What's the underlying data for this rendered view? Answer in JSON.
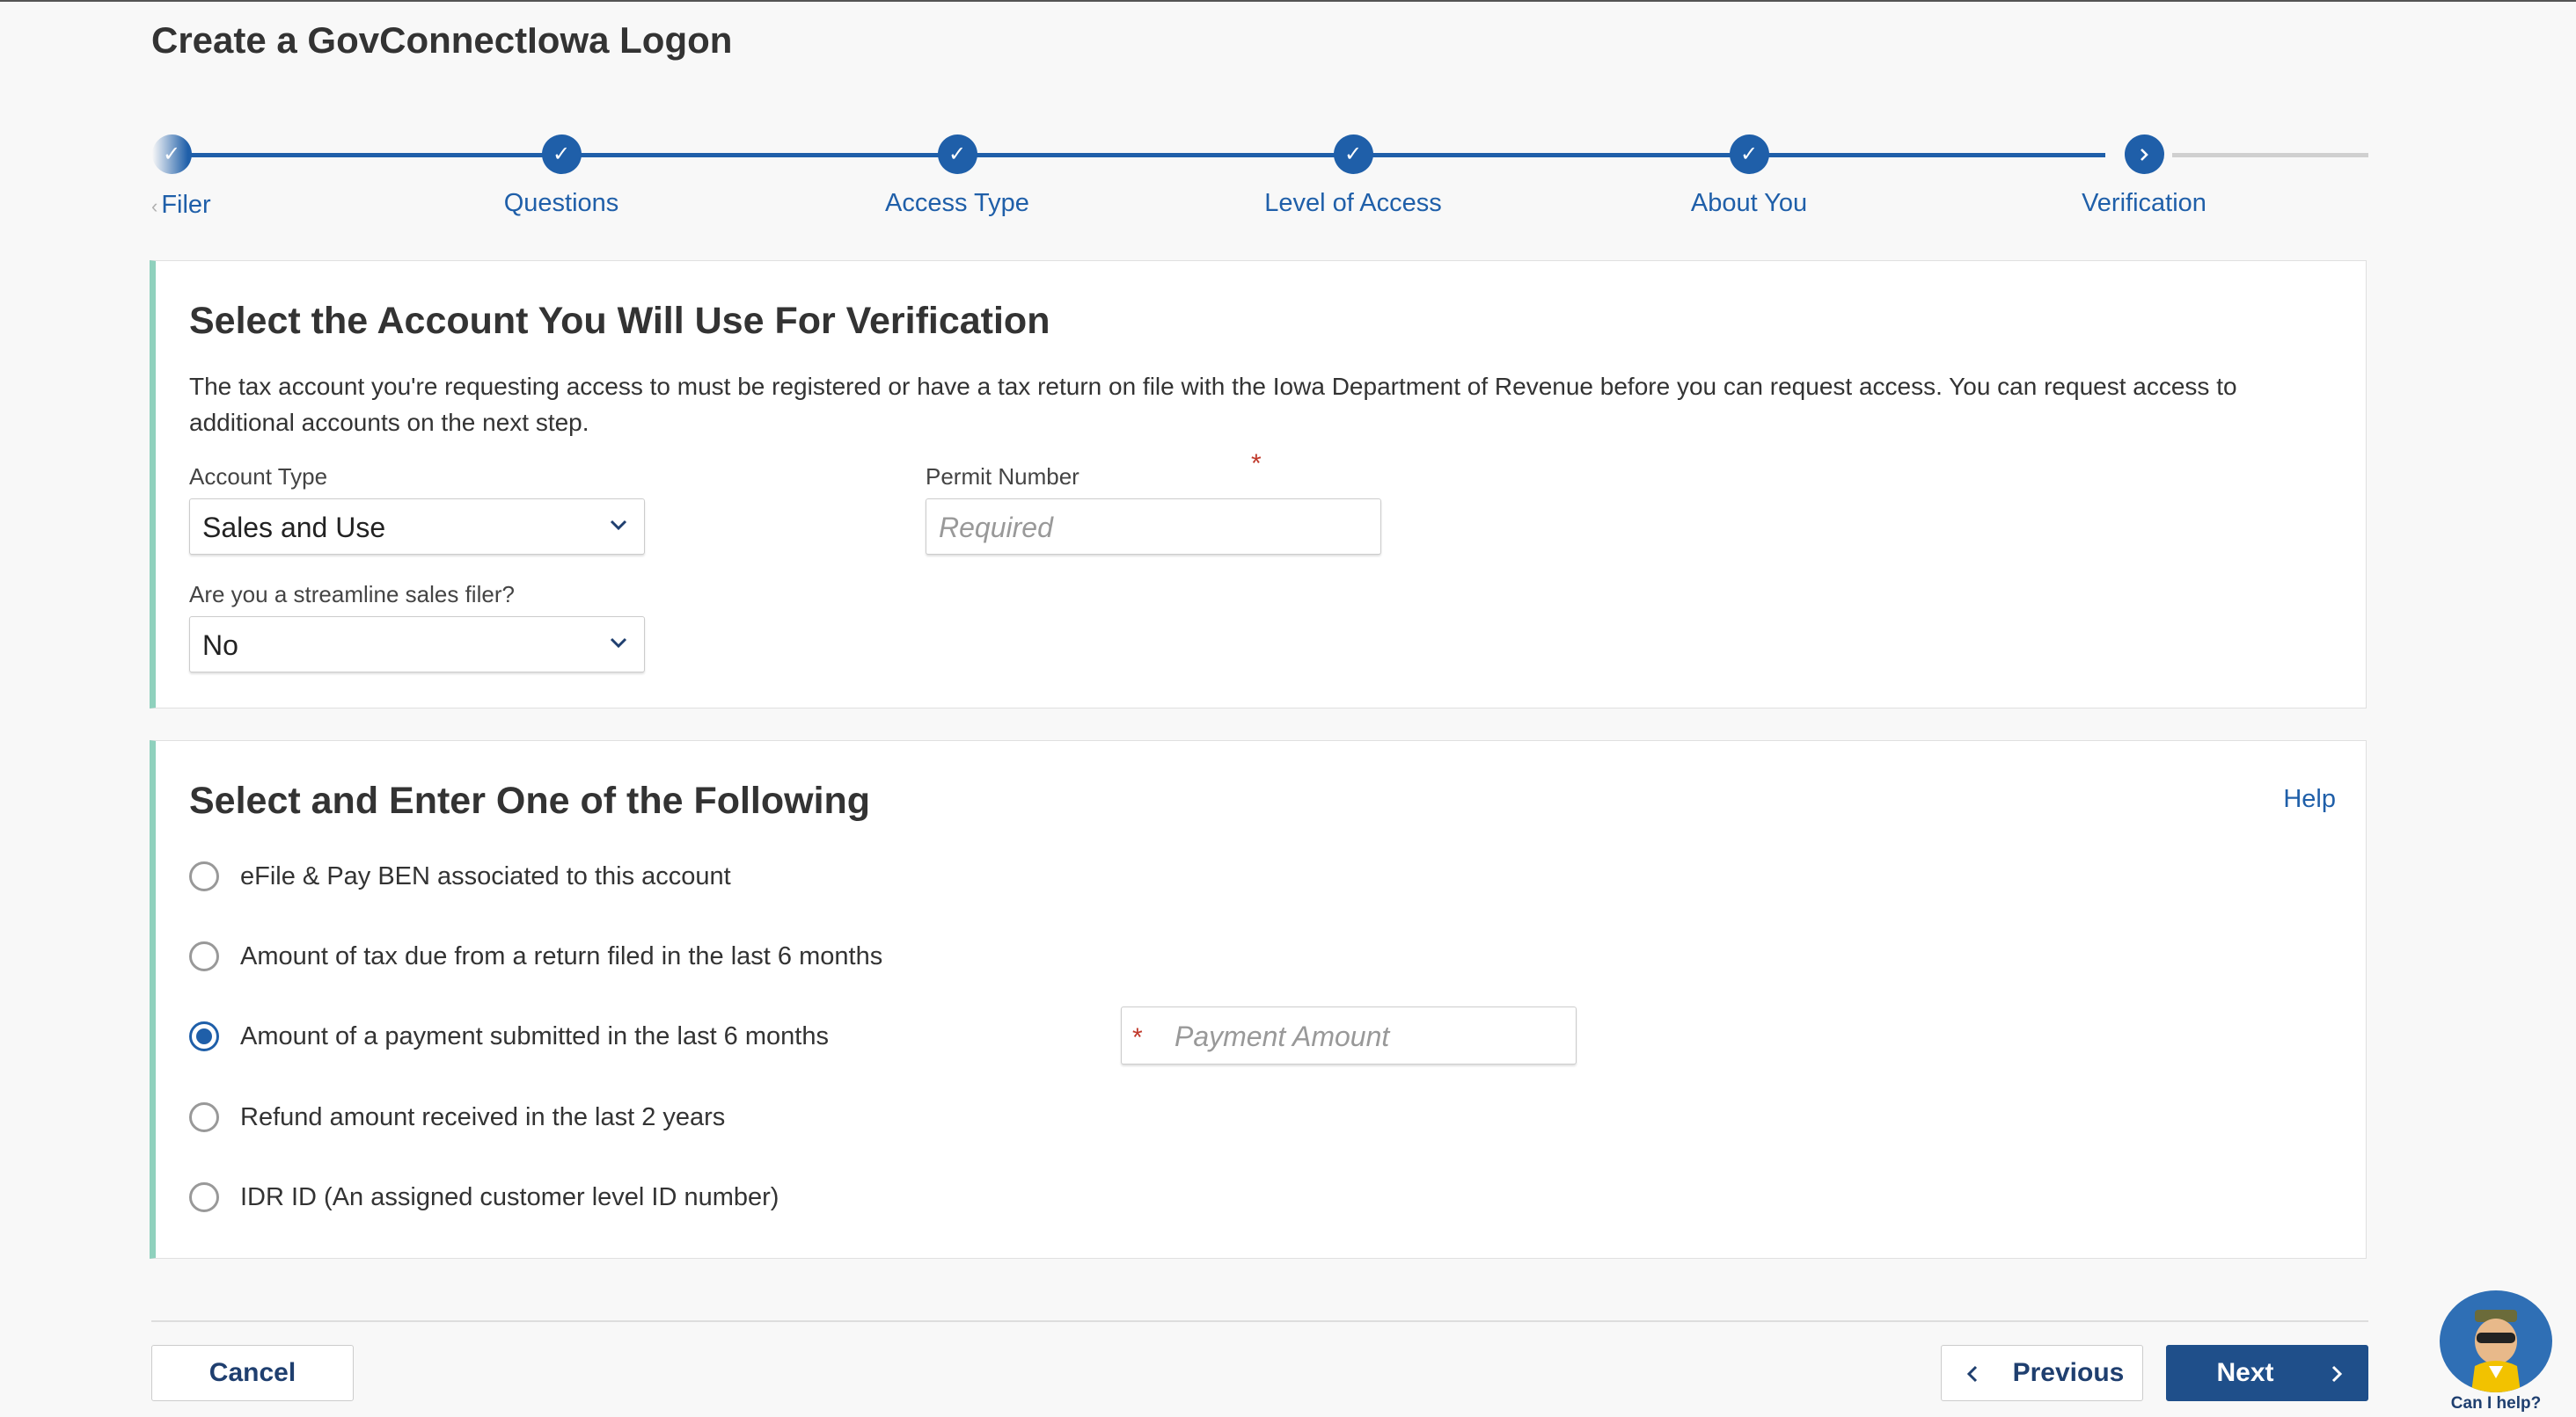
{
  "page": {
    "title": "Create a GovConnectIowa Logon"
  },
  "stepper": {
    "steps": [
      {
        "label": "Filer",
        "status": "complete"
      },
      {
        "label": "Questions",
        "status": "complete"
      },
      {
        "label": "Access Type",
        "status": "complete"
      },
      {
        "label": "Level of Access",
        "status": "complete"
      },
      {
        "label": "About You",
        "status": "complete"
      },
      {
        "label": "Verification",
        "status": "current"
      }
    ]
  },
  "account_section": {
    "heading": "Select the Account You Will Use For Verification",
    "description": "The tax account you're requesting access to must be registered or have a tax return on file with the Iowa Department of Revenue before you can request access. You can request access to additional accounts on the next step.",
    "account_type": {
      "label": "Account Type",
      "value": "Sales and Use"
    },
    "permit_number": {
      "label": "Permit Number",
      "placeholder": "Required",
      "required_mark": "*"
    },
    "streamline": {
      "label": "Are you a streamline sales filer?",
      "value": "No"
    }
  },
  "options_section": {
    "heading": "Select and Enter One of the Following",
    "help_label": "Help",
    "options": [
      {
        "label": "eFile & Pay BEN associated to this account",
        "selected": false
      },
      {
        "label": "Amount of tax due from a return filed in the last 6 months",
        "selected": false
      },
      {
        "label": "Amount of a payment submitted in the last 6 months",
        "selected": true
      },
      {
        "label": "Refund amount received in the last 2 years",
        "selected": false
      },
      {
        "label": "IDR ID (An assigned customer level ID number)",
        "selected": false
      }
    ],
    "payment_amount": {
      "placeholder": "Payment Amount",
      "required_mark": "*"
    }
  },
  "footer": {
    "cancel_label": "Cancel",
    "previous_label": "Previous",
    "next_label": "Next"
  },
  "helper": {
    "caption": "Can I help?"
  },
  "colors": {
    "primary": "#1f5fa9",
    "accent_border": "#8fd1bd",
    "required": "#c0392b",
    "next_button": "#1f4f8a"
  }
}
